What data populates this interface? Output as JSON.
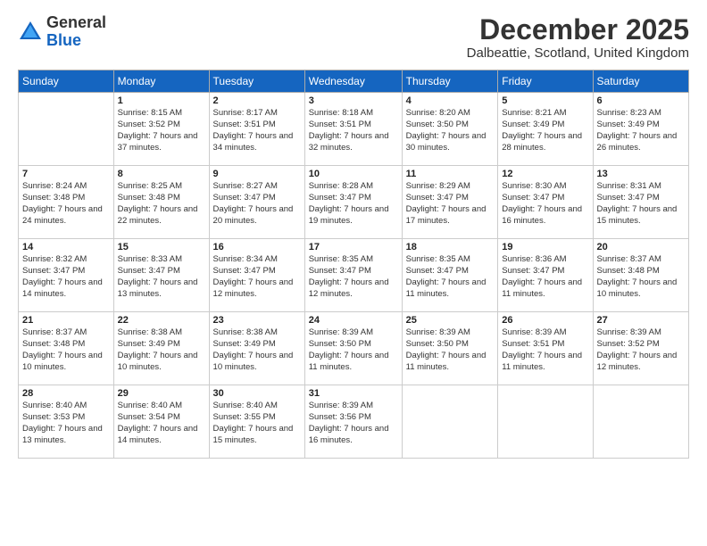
{
  "logo": {
    "general": "General",
    "blue": "Blue"
  },
  "header": {
    "month": "December 2025",
    "location": "Dalbeattie, Scotland, United Kingdom"
  },
  "days_of_week": [
    "Sunday",
    "Monday",
    "Tuesday",
    "Wednesday",
    "Thursday",
    "Friday",
    "Saturday"
  ],
  "weeks": [
    [
      {
        "num": "",
        "sunrise": "",
        "sunset": "",
        "daylight": ""
      },
      {
        "num": "1",
        "sunrise": "Sunrise: 8:15 AM",
        "sunset": "Sunset: 3:52 PM",
        "daylight": "Daylight: 7 hours and 37 minutes."
      },
      {
        "num": "2",
        "sunrise": "Sunrise: 8:17 AM",
        "sunset": "Sunset: 3:51 PM",
        "daylight": "Daylight: 7 hours and 34 minutes."
      },
      {
        "num": "3",
        "sunrise": "Sunrise: 8:18 AM",
        "sunset": "Sunset: 3:51 PM",
        "daylight": "Daylight: 7 hours and 32 minutes."
      },
      {
        "num": "4",
        "sunrise": "Sunrise: 8:20 AM",
        "sunset": "Sunset: 3:50 PM",
        "daylight": "Daylight: 7 hours and 30 minutes."
      },
      {
        "num": "5",
        "sunrise": "Sunrise: 8:21 AM",
        "sunset": "Sunset: 3:49 PM",
        "daylight": "Daylight: 7 hours and 28 minutes."
      },
      {
        "num": "6",
        "sunrise": "Sunrise: 8:23 AM",
        "sunset": "Sunset: 3:49 PM",
        "daylight": "Daylight: 7 hours and 26 minutes."
      }
    ],
    [
      {
        "num": "7",
        "sunrise": "Sunrise: 8:24 AM",
        "sunset": "Sunset: 3:48 PM",
        "daylight": "Daylight: 7 hours and 24 minutes."
      },
      {
        "num": "8",
        "sunrise": "Sunrise: 8:25 AM",
        "sunset": "Sunset: 3:48 PM",
        "daylight": "Daylight: 7 hours and 22 minutes."
      },
      {
        "num": "9",
        "sunrise": "Sunrise: 8:27 AM",
        "sunset": "Sunset: 3:47 PM",
        "daylight": "Daylight: 7 hours and 20 minutes."
      },
      {
        "num": "10",
        "sunrise": "Sunrise: 8:28 AM",
        "sunset": "Sunset: 3:47 PM",
        "daylight": "Daylight: 7 hours and 19 minutes."
      },
      {
        "num": "11",
        "sunrise": "Sunrise: 8:29 AM",
        "sunset": "Sunset: 3:47 PM",
        "daylight": "Daylight: 7 hours and 17 minutes."
      },
      {
        "num": "12",
        "sunrise": "Sunrise: 8:30 AM",
        "sunset": "Sunset: 3:47 PM",
        "daylight": "Daylight: 7 hours and 16 minutes."
      },
      {
        "num": "13",
        "sunrise": "Sunrise: 8:31 AM",
        "sunset": "Sunset: 3:47 PM",
        "daylight": "Daylight: 7 hours and 15 minutes."
      }
    ],
    [
      {
        "num": "14",
        "sunrise": "Sunrise: 8:32 AM",
        "sunset": "Sunset: 3:47 PM",
        "daylight": "Daylight: 7 hours and 14 minutes."
      },
      {
        "num": "15",
        "sunrise": "Sunrise: 8:33 AM",
        "sunset": "Sunset: 3:47 PM",
        "daylight": "Daylight: 7 hours and 13 minutes."
      },
      {
        "num": "16",
        "sunrise": "Sunrise: 8:34 AM",
        "sunset": "Sunset: 3:47 PM",
        "daylight": "Daylight: 7 hours and 12 minutes."
      },
      {
        "num": "17",
        "sunrise": "Sunrise: 8:35 AM",
        "sunset": "Sunset: 3:47 PM",
        "daylight": "Daylight: 7 hours and 12 minutes."
      },
      {
        "num": "18",
        "sunrise": "Sunrise: 8:35 AM",
        "sunset": "Sunset: 3:47 PM",
        "daylight": "Daylight: 7 hours and 11 minutes."
      },
      {
        "num": "19",
        "sunrise": "Sunrise: 8:36 AM",
        "sunset": "Sunset: 3:47 PM",
        "daylight": "Daylight: 7 hours and 11 minutes."
      },
      {
        "num": "20",
        "sunrise": "Sunrise: 8:37 AM",
        "sunset": "Sunset: 3:48 PM",
        "daylight": "Daylight: 7 hours and 10 minutes."
      }
    ],
    [
      {
        "num": "21",
        "sunrise": "Sunrise: 8:37 AM",
        "sunset": "Sunset: 3:48 PM",
        "daylight": "Daylight: 7 hours and 10 minutes."
      },
      {
        "num": "22",
        "sunrise": "Sunrise: 8:38 AM",
        "sunset": "Sunset: 3:49 PM",
        "daylight": "Daylight: 7 hours and 10 minutes."
      },
      {
        "num": "23",
        "sunrise": "Sunrise: 8:38 AM",
        "sunset": "Sunset: 3:49 PM",
        "daylight": "Daylight: 7 hours and 10 minutes."
      },
      {
        "num": "24",
        "sunrise": "Sunrise: 8:39 AM",
        "sunset": "Sunset: 3:50 PM",
        "daylight": "Daylight: 7 hours and 11 minutes."
      },
      {
        "num": "25",
        "sunrise": "Sunrise: 8:39 AM",
        "sunset": "Sunset: 3:50 PM",
        "daylight": "Daylight: 7 hours and 11 minutes."
      },
      {
        "num": "26",
        "sunrise": "Sunrise: 8:39 AM",
        "sunset": "Sunset: 3:51 PM",
        "daylight": "Daylight: 7 hours and 11 minutes."
      },
      {
        "num": "27",
        "sunrise": "Sunrise: 8:39 AM",
        "sunset": "Sunset: 3:52 PM",
        "daylight": "Daylight: 7 hours and 12 minutes."
      }
    ],
    [
      {
        "num": "28",
        "sunrise": "Sunrise: 8:40 AM",
        "sunset": "Sunset: 3:53 PM",
        "daylight": "Daylight: 7 hours and 13 minutes."
      },
      {
        "num": "29",
        "sunrise": "Sunrise: 8:40 AM",
        "sunset": "Sunset: 3:54 PM",
        "daylight": "Daylight: 7 hours and 14 minutes."
      },
      {
        "num": "30",
        "sunrise": "Sunrise: 8:40 AM",
        "sunset": "Sunset: 3:55 PM",
        "daylight": "Daylight: 7 hours and 15 minutes."
      },
      {
        "num": "31",
        "sunrise": "Sunrise: 8:39 AM",
        "sunset": "Sunset: 3:56 PM",
        "daylight": "Daylight: 7 hours and 16 minutes."
      },
      {
        "num": "",
        "sunrise": "",
        "sunset": "",
        "daylight": ""
      },
      {
        "num": "",
        "sunrise": "",
        "sunset": "",
        "daylight": ""
      },
      {
        "num": "",
        "sunrise": "",
        "sunset": "",
        "daylight": ""
      }
    ]
  ]
}
